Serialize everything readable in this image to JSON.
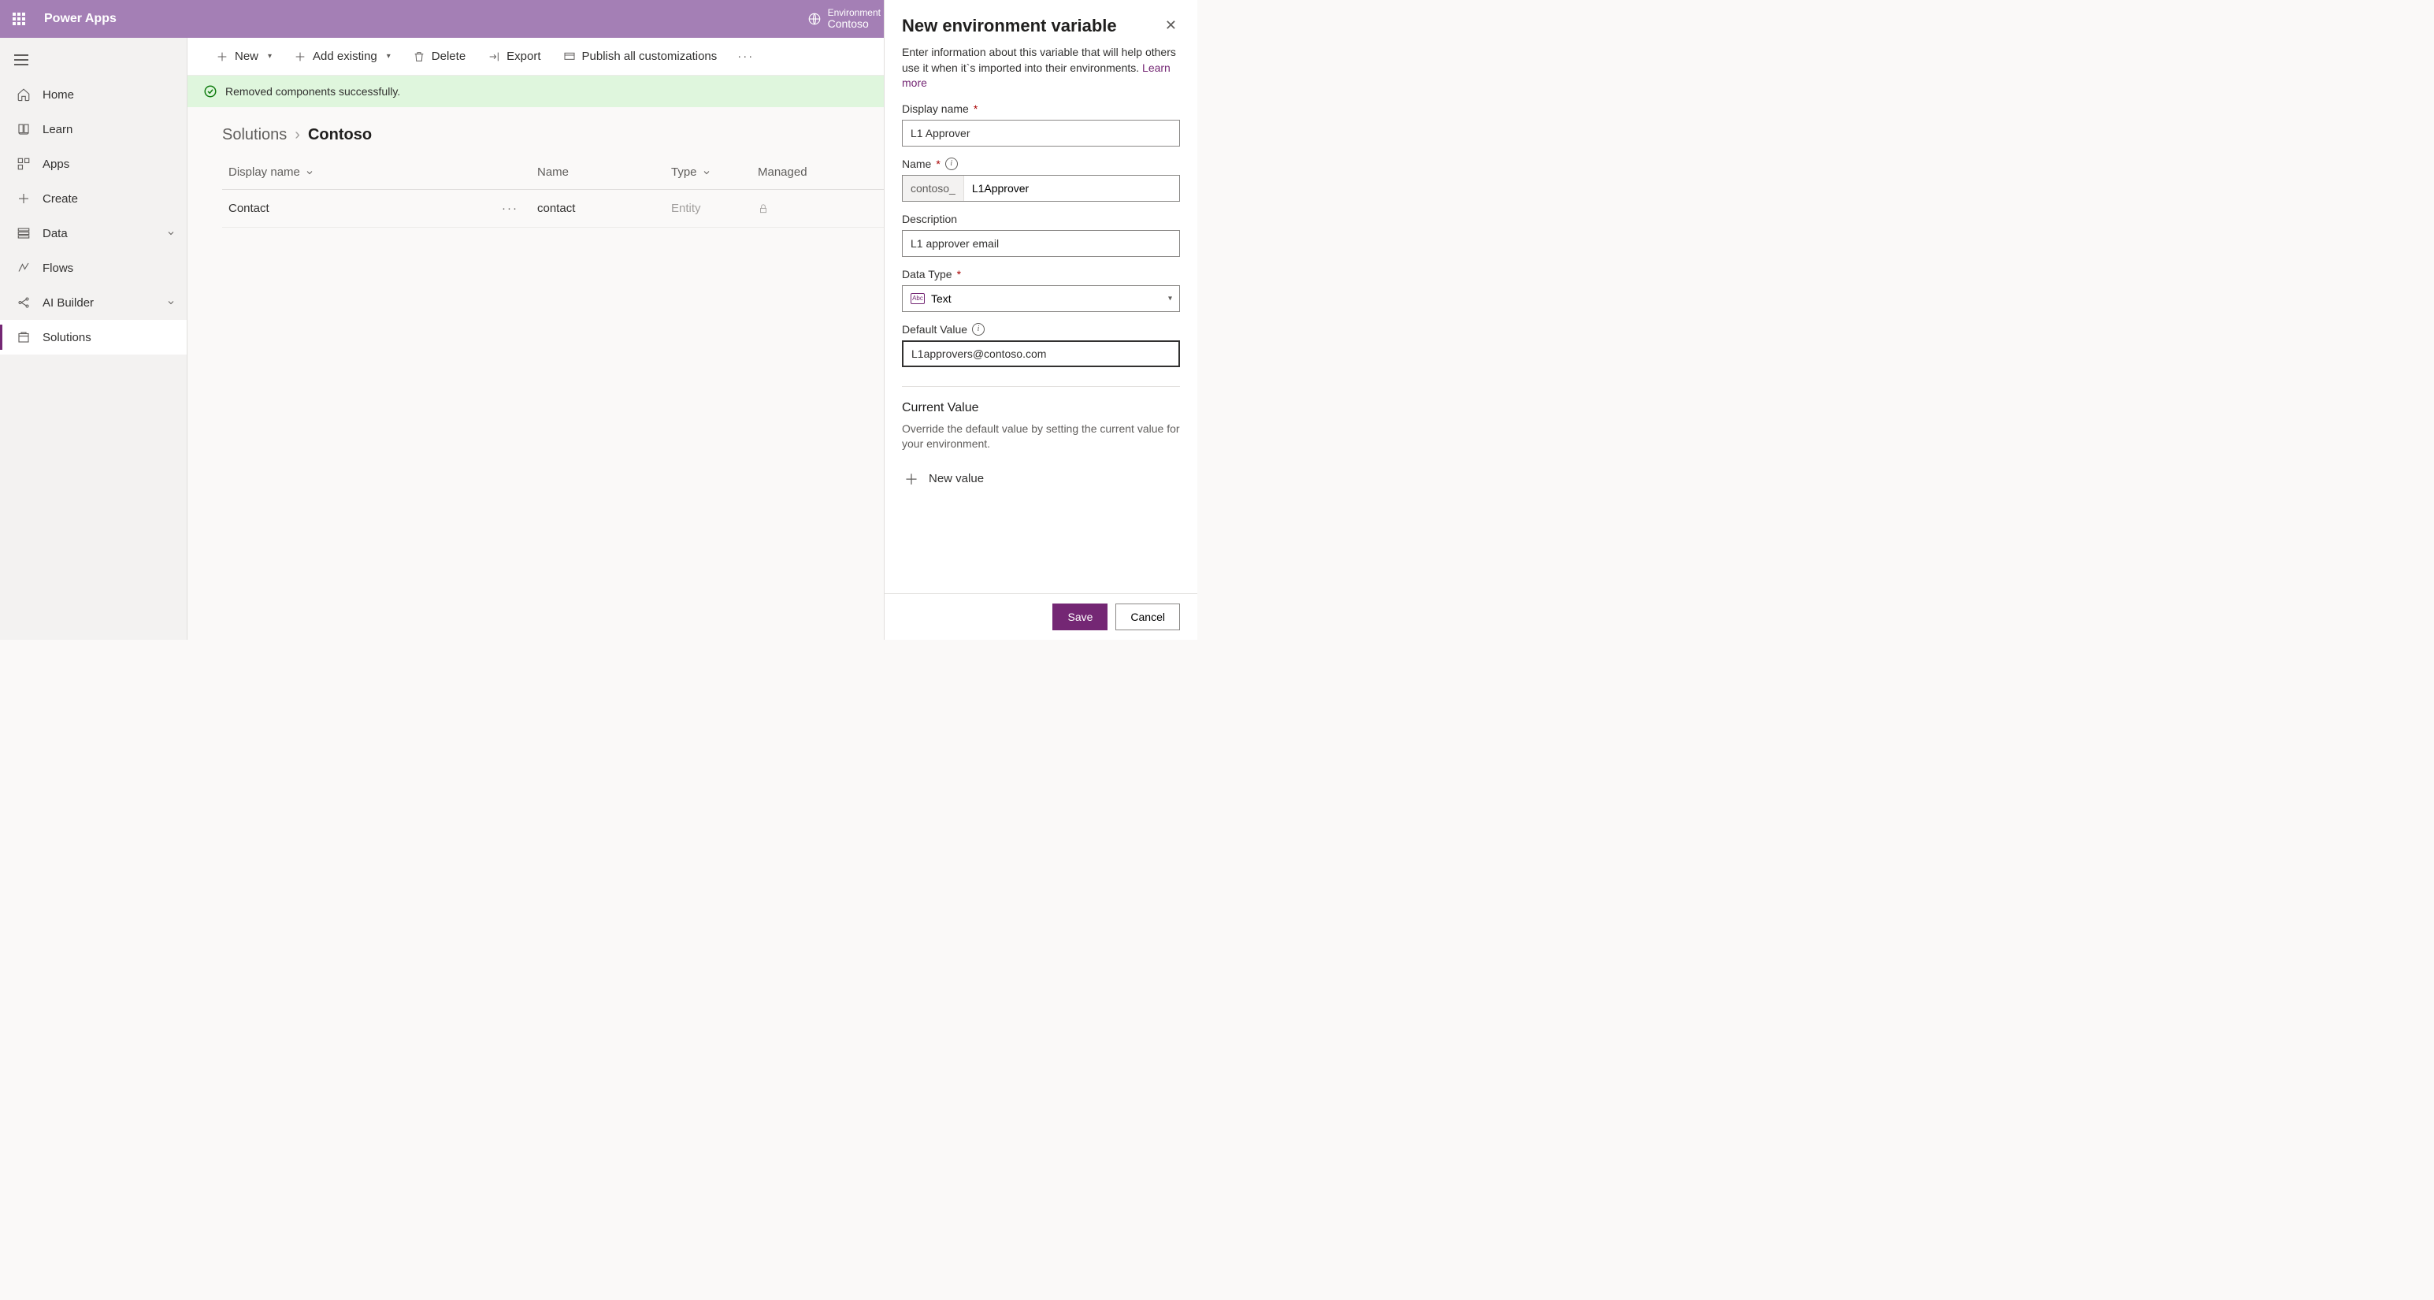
{
  "header": {
    "app_title": "Power Apps",
    "env_label": "Environment",
    "env_name": "Contoso"
  },
  "sidebar": {
    "items": [
      {
        "label": "Home"
      },
      {
        "label": "Learn"
      },
      {
        "label": "Apps"
      },
      {
        "label": "Create"
      },
      {
        "label": "Data"
      },
      {
        "label": "Flows"
      },
      {
        "label": "AI Builder"
      },
      {
        "label": "Solutions"
      }
    ]
  },
  "commands": {
    "new": "New",
    "add_existing": "Add existing",
    "delete": "Delete",
    "export": "Export",
    "publish": "Publish all customizations"
  },
  "notification": "Removed components successfully.",
  "breadcrumb": {
    "root": "Solutions",
    "current": "Contoso"
  },
  "table": {
    "columns": {
      "display_name": "Display name",
      "name": "Name",
      "type": "Type",
      "managed": "Managed"
    },
    "rows": [
      {
        "display_name": "Contact",
        "name": "contact",
        "type": "Entity"
      }
    ]
  },
  "panel": {
    "title": "New environment variable",
    "description": "Enter information about this variable that will help others use it when it`s imported into their environments. ",
    "learn_more": "Learn more",
    "fields": {
      "display_name": {
        "label": "Display name",
        "value": "L1 Approver"
      },
      "name": {
        "label": "Name",
        "prefix": "contoso_",
        "value": "L1Approver"
      },
      "description": {
        "label": "Description",
        "value": "L1 approver email"
      },
      "data_type": {
        "label": "Data Type",
        "value": "Text"
      },
      "default_value": {
        "label": "Default Value",
        "value": "L1approvers@contoso.com"
      }
    },
    "current_value": {
      "title": "Current Value",
      "description": "Override the default value by setting the current value for your environment.",
      "new_value": "New value"
    },
    "buttons": {
      "save": "Save",
      "cancel": "Cancel"
    }
  }
}
